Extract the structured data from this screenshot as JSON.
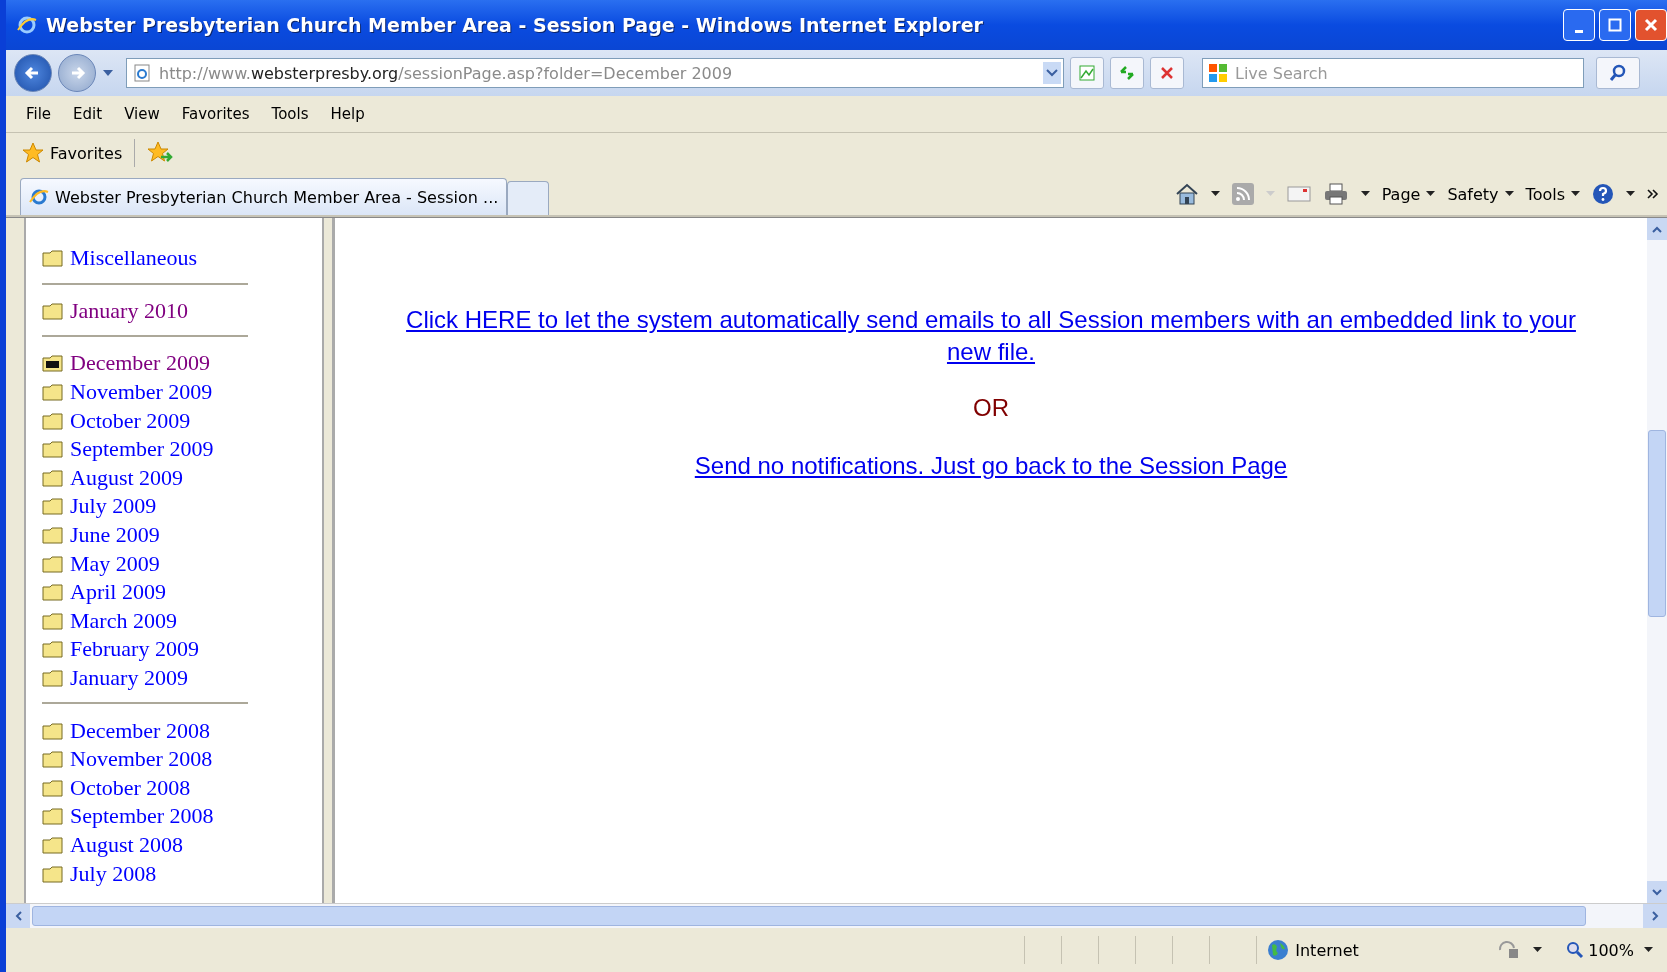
{
  "window": {
    "title": "Webster Presbyterian Church Member Area - Session Page - Windows Internet Explorer"
  },
  "address": {
    "prefix": "http://www.",
    "domain": "websterpresby.org",
    "path": "/sessionPage.asp?folder=December 2009"
  },
  "search": {
    "placeholder": "Live Search"
  },
  "menu": [
    "File",
    "Edit",
    "View",
    "Favorites",
    "Tools",
    "Help"
  ],
  "favorites_label": "Favorites",
  "tabs": [
    {
      "label": "Webster Presbyterian Church Member Area - Session ...",
      "selected": true
    }
  ],
  "command_bar": [
    "Page",
    "Safety",
    "Tools"
  ],
  "folder_groups": [
    [
      {
        "label": "Miscellaneous",
        "visited": false,
        "selected": false
      }
    ],
    [
      {
        "label": "January 2010",
        "visited": true,
        "selected": false
      }
    ],
    [
      {
        "label": "December 2009",
        "visited": true,
        "selected": true
      },
      {
        "label": "November 2009",
        "visited": false,
        "selected": false
      },
      {
        "label": "October 2009",
        "visited": false,
        "selected": false
      },
      {
        "label": "September 2009",
        "visited": false,
        "selected": false
      },
      {
        "label": "August 2009",
        "visited": false,
        "selected": false
      },
      {
        "label": "July 2009",
        "visited": false,
        "selected": false
      },
      {
        "label": "June 2009",
        "visited": false,
        "selected": false
      },
      {
        "label": "May 2009",
        "visited": false,
        "selected": false
      },
      {
        "label": "April 2009",
        "visited": false,
        "selected": false
      },
      {
        "label": "March 2009",
        "visited": false,
        "selected": false
      },
      {
        "label": "February 2009",
        "visited": false,
        "selected": false
      },
      {
        "label": "January 2009",
        "visited": false,
        "selected": false
      }
    ],
    [
      {
        "label": "December 2008",
        "visited": false,
        "selected": false
      },
      {
        "label": "November 2008",
        "visited": false,
        "selected": false
      },
      {
        "label": "October 2008",
        "visited": false,
        "selected": false
      },
      {
        "label": "September 2008",
        "visited": false,
        "selected": false
      },
      {
        "label": "August 2008",
        "visited": false,
        "selected": false
      },
      {
        "label": "July 2008",
        "visited": false,
        "selected": false
      }
    ]
  ],
  "main": {
    "send_link": "Click HERE to let the system automatically send emails to all Session members with an embedded link to your new file.",
    "or": "OR",
    "back_link": "Send no notifications. Just go back to the Session Page"
  },
  "status_bar": {
    "zone": "Internet",
    "zoom": "100%"
  }
}
